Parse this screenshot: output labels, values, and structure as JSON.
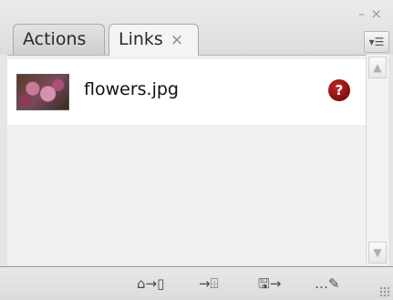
{
  "window": {
    "minimize_glyph": "–",
    "close_glyph": "×"
  },
  "tabs": [
    {
      "label": "Actions",
      "active": false
    },
    {
      "label": "Links",
      "active": true,
      "close_glyph": "×"
    }
  ],
  "panel_menu": {
    "icon": "panel-menu-icon",
    "glyph": "▾☰"
  },
  "links": [
    {
      "filename": "flowers.jpg",
      "status_icon": "missing-link-icon",
      "status_glyph": "?"
    }
  ],
  "scrollbar": {
    "up_glyph": "▲",
    "down_glyph": "▼"
  },
  "toolbar": [
    {
      "name": "relink-button",
      "icon": "relink-icon",
      "glyph": "⌂→▯"
    },
    {
      "name": "go-to-link-button",
      "icon": "go-to-link-icon",
      "glyph": "→⌹"
    },
    {
      "name": "update-link-button",
      "icon": "update-link-icon",
      "glyph": "🖫→"
    },
    {
      "name": "edit-original-button",
      "icon": "edit-original-icon",
      "glyph": "…✎"
    }
  ],
  "colors": {
    "panel_bg": "#e6e6e6",
    "list_bg": "#f0f0f0",
    "row_bg": "#ffffff",
    "missing_red": "#b01e22"
  }
}
